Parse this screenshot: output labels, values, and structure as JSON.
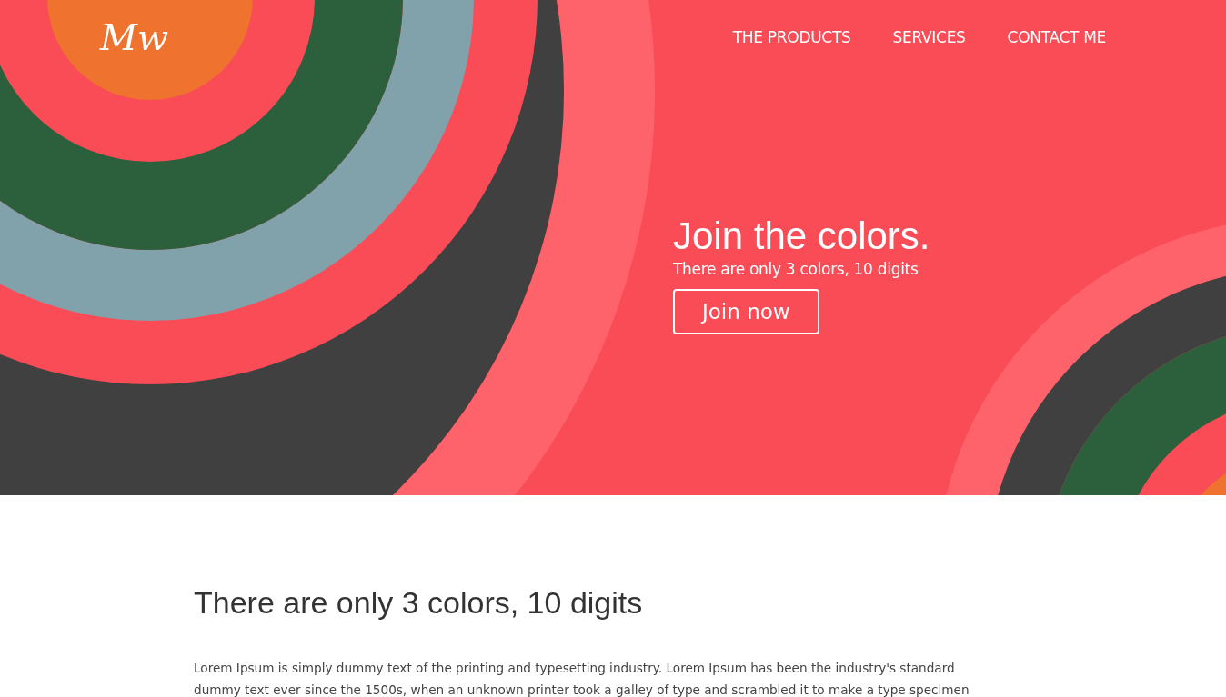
{
  "header": {
    "logo": "Mw",
    "nav": [
      {
        "label": "THE PRODUCTS"
      },
      {
        "label": "SERVICES"
      },
      {
        "label": "CONTACT ME"
      }
    ]
  },
  "hero": {
    "title": "Join the colors.",
    "subtitle": "There are only 3 colors, 10 digits",
    "button": "Join now"
  },
  "content": {
    "heading": "There are only 3 colors, 10 digits",
    "lines": [
      "Lorem Ipsum is simply dummy text of the printing and typesetting industry. Lorem Ipsum has been the industry's standard",
      "dummy text ever since the 1500s, when an unknown printer took a galley of type and scrambled it to make a type specimen"
    ]
  }
}
